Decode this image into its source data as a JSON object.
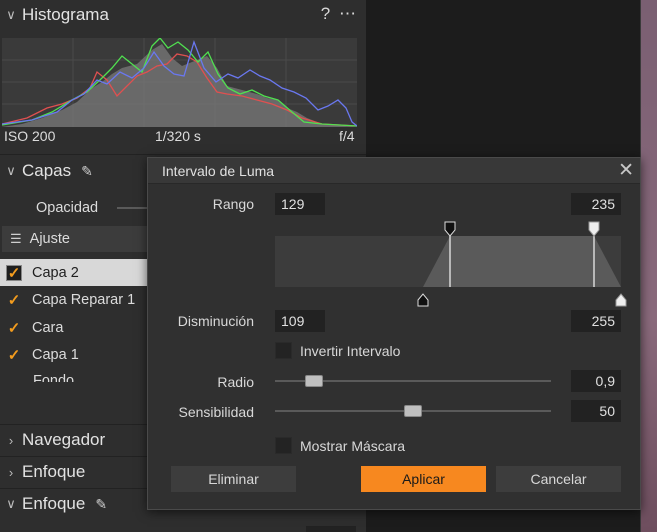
{
  "histogram": {
    "title": "Histograma",
    "help_icon": "?",
    "menu_icon": "⋯",
    "iso": "ISO 200",
    "shutter": "1/320 s",
    "aperture": "f/4"
  },
  "layers": {
    "title": "Capas",
    "opacity_label": "Opacidad",
    "adjust_label": "Ajuste",
    "items": [
      {
        "label": "Capa 2",
        "checked": true,
        "selected": true
      },
      {
        "label": "Capa Reparar 1",
        "checked": true
      },
      {
        "label": "Cara",
        "checked": true
      },
      {
        "label": "Capa 1",
        "checked": true
      },
      {
        "label": "Fondo",
        "checked": false
      }
    ]
  },
  "sections": {
    "navigator": "Navegador",
    "focus1": "Enfoque",
    "focus2": "Enfoque"
  },
  "dialog": {
    "title": "Intervalo de Luma",
    "close_icon": "✕",
    "range_label": "Rango",
    "range_low": "129",
    "range_high": "235",
    "falloff_label": "Disminución",
    "falloff_low": "109",
    "falloff_high": "255",
    "invert_label": "Invertir Intervalo",
    "radius_label": "Radio",
    "radius_value": "0,9",
    "sensitivity_label": "Sensibilidad",
    "sensitivity_value": "50",
    "show_mask_label": "Mostrar Máscara",
    "delete_label": "Eliminar",
    "apply_label": "Aplicar",
    "cancel_label": "Cancelar"
  },
  "colors": {
    "accent": "#f7881f",
    "check": "#f39c1e"
  }
}
